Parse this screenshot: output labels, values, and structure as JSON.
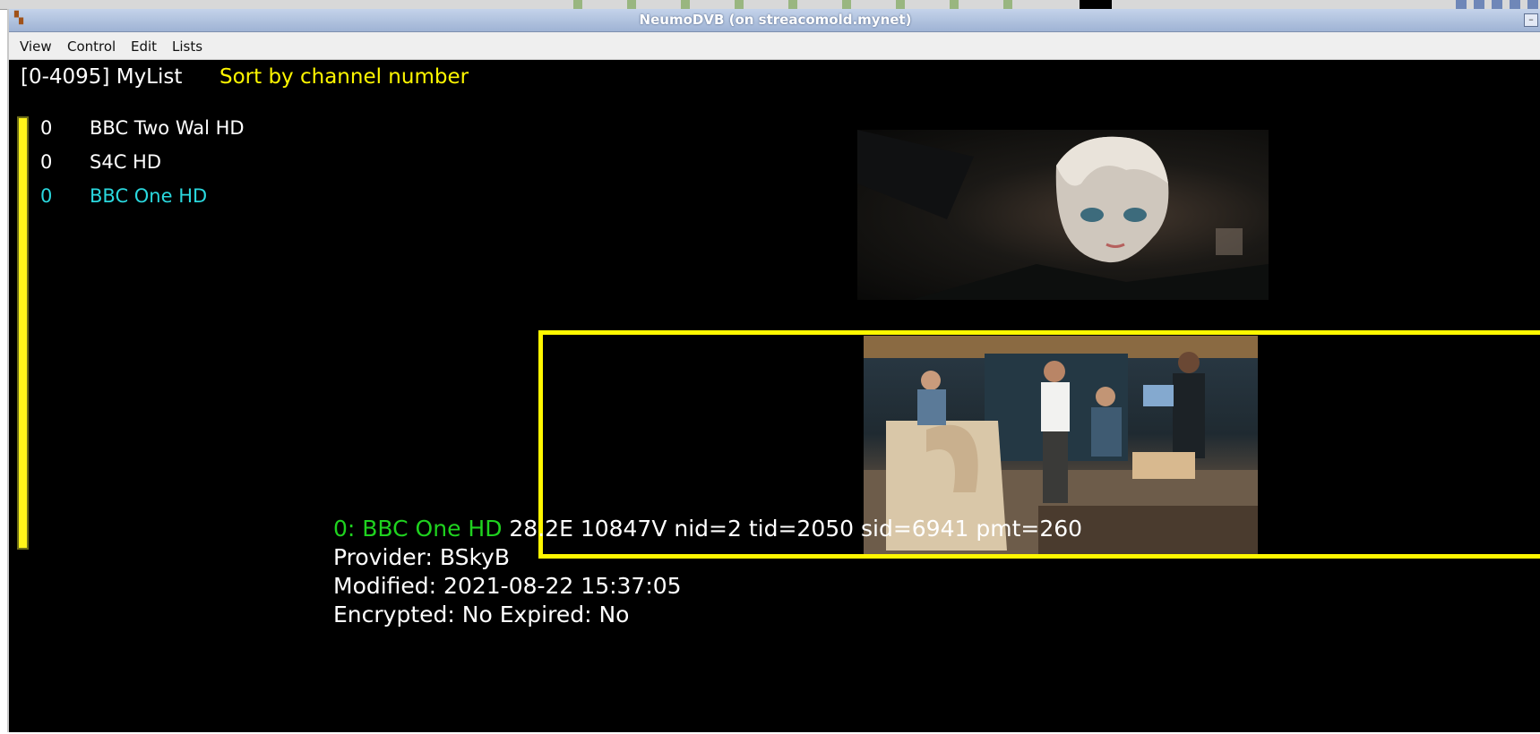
{
  "window": {
    "title": "NeumoDVB (on streacomold.mynet)"
  },
  "menu": [
    "View",
    "Control",
    "Edit",
    "Lists"
  ],
  "list": {
    "range_name": "[0-4095] MyList",
    "sort_label": "Sort by channel number",
    "rows": [
      {
        "number": "0",
        "name": "BBC Two Wal HD",
        "selected": false
      },
      {
        "number": "0",
        "name": "S4C HD",
        "selected": false
      },
      {
        "number": "0",
        "name": "BBC One HD",
        "selected": true
      }
    ]
  },
  "info": {
    "channel": "0: BBC One HD",
    "mux": "28.2E 10847V nid=2 tid=2050 sid=6941 pmt=260",
    "provider": "Provider: BSkyB",
    "modified": "Modified: 2021-08-22 15:37:05",
    "flags": "Encrypted: No Expired: No"
  },
  "colors": {
    "background": "#000000",
    "accent_yellow": "#fff700",
    "selected_cyan": "#2ad8de",
    "channel_green": "#1fd21f"
  }
}
